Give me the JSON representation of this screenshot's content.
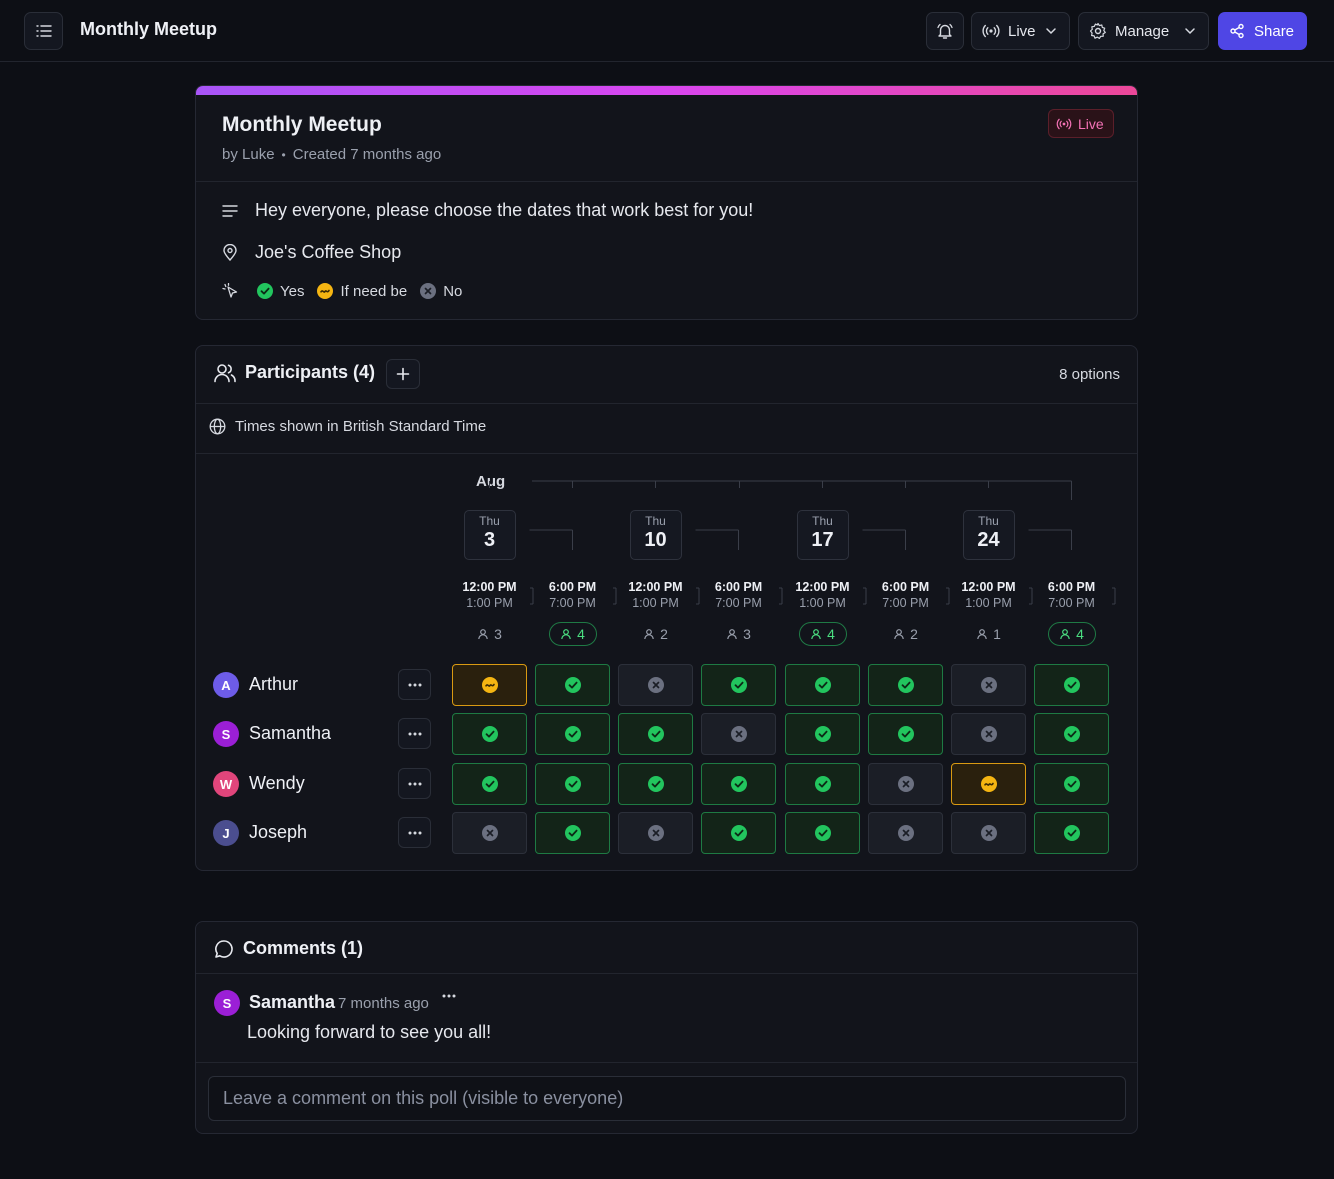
{
  "header": {
    "title": "Monthly Meetup",
    "live_label": "Live",
    "manage_label": "Manage",
    "share_label": "Share"
  },
  "poll": {
    "title": "Monthly Meetup",
    "author": "by Luke",
    "created": "Created 7 months ago",
    "status_badge": "Live",
    "description": "Hey everyone, please choose the dates that work best for you!",
    "location": "Joe's Coffee Shop",
    "legend": {
      "yes": "Yes",
      "maybe": "If need be",
      "no": "No"
    }
  },
  "participants": {
    "title": "Participants (4)",
    "options_count": "8 options",
    "timezone_note": "Times shown in British Standard Time",
    "month": "Aug",
    "dates": [
      {
        "dow": "Thu",
        "day": "3"
      },
      {
        "dow": "Thu",
        "day": "10"
      },
      {
        "dow": "Thu",
        "day": "17"
      },
      {
        "dow": "Thu",
        "day": "24"
      }
    ],
    "slots": [
      {
        "start": "12:00 PM",
        "end": "1:00 PM",
        "count": "3",
        "best": false
      },
      {
        "start": "6:00 PM",
        "end": "7:00 PM",
        "count": "4",
        "best": true
      },
      {
        "start": "12:00 PM",
        "end": "1:00 PM",
        "count": "2",
        "best": false
      },
      {
        "start": "6:00 PM",
        "end": "7:00 PM",
        "count": "3",
        "best": false
      },
      {
        "start": "12:00 PM",
        "end": "1:00 PM",
        "count": "4",
        "best": true
      },
      {
        "start": "6:00 PM",
        "end": "7:00 PM",
        "count": "2",
        "best": false
      },
      {
        "start": "12:00 PM",
        "end": "1:00 PM",
        "count": "1",
        "best": false
      },
      {
        "start": "6:00 PM",
        "end": "7:00 PM",
        "count": "4",
        "best": true
      }
    ],
    "people": [
      {
        "name": "Arthur",
        "initial": "A",
        "color": "#6d5ce8",
        "votes": [
          "maybe",
          "yes",
          "no",
          "yes",
          "yes",
          "yes",
          "no",
          "yes"
        ]
      },
      {
        "name": "Samantha",
        "initial": "S",
        "color": "#9b1fd6",
        "votes": [
          "yes",
          "yes",
          "yes",
          "no",
          "yes",
          "yes",
          "no",
          "yes"
        ]
      },
      {
        "name": "Wendy",
        "initial": "W",
        "color": "#e0457b",
        "votes": [
          "yes",
          "yes",
          "yes",
          "yes",
          "yes",
          "no",
          "maybe",
          "yes"
        ]
      },
      {
        "name": "Joseph",
        "initial": "J",
        "color": "#4b4e8f",
        "votes": [
          "no",
          "yes",
          "no",
          "yes",
          "yes",
          "no",
          "no",
          "yes"
        ]
      }
    ]
  },
  "comments": {
    "title": "Comments (1)",
    "items": [
      {
        "author": "Samantha",
        "initial": "S",
        "color": "#9b1fd6",
        "time": "7 months ago",
        "text": "Looking forward to see you all!"
      }
    ],
    "input_placeholder": "Leave a comment on this poll (visible to everyone)"
  },
  "colors": {
    "accent": "#4f46e5",
    "yes": "#22c55e",
    "maybe": "#f5b512",
    "no": "#6b7080"
  },
  "icons": [
    "menu-icon",
    "bell-icon",
    "live-icon",
    "gear-icon",
    "chevron-down-icon",
    "share-icon",
    "text-icon",
    "pin-icon",
    "sparkle-icon",
    "users-icon",
    "plus-icon",
    "globe-icon",
    "user-icon",
    "more-icon",
    "chat-icon"
  ]
}
